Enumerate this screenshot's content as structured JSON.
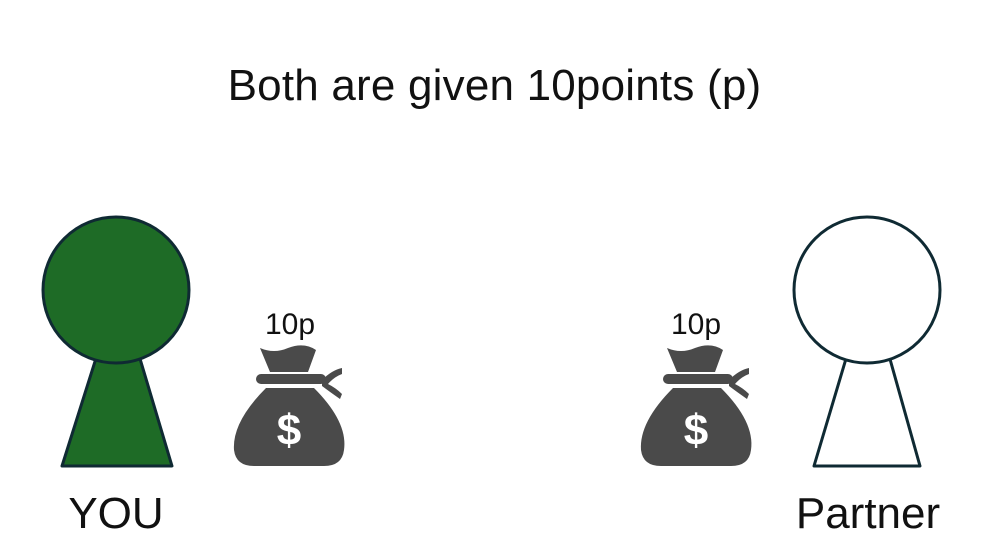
{
  "title": "Both are given 10points (p)",
  "players": {
    "you": {
      "label": "YOU",
      "body_color": "#1E6B26",
      "outline_color": "#0F2A33",
      "icon": "person-pawn-filled-icon"
    },
    "partner": {
      "label": "Partner",
      "body_color": "#FFFFFF",
      "outline_color": "#0F2A33",
      "icon": "person-pawn-outline-icon"
    }
  },
  "bags": {
    "you": {
      "amount": "10p",
      "icon": "money-bag-icon",
      "symbol": "$",
      "color": "#4A4A4A"
    },
    "partner": {
      "amount": "10p",
      "icon": "money-bag-icon",
      "symbol": "$",
      "color": "#4A4A4A"
    }
  }
}
